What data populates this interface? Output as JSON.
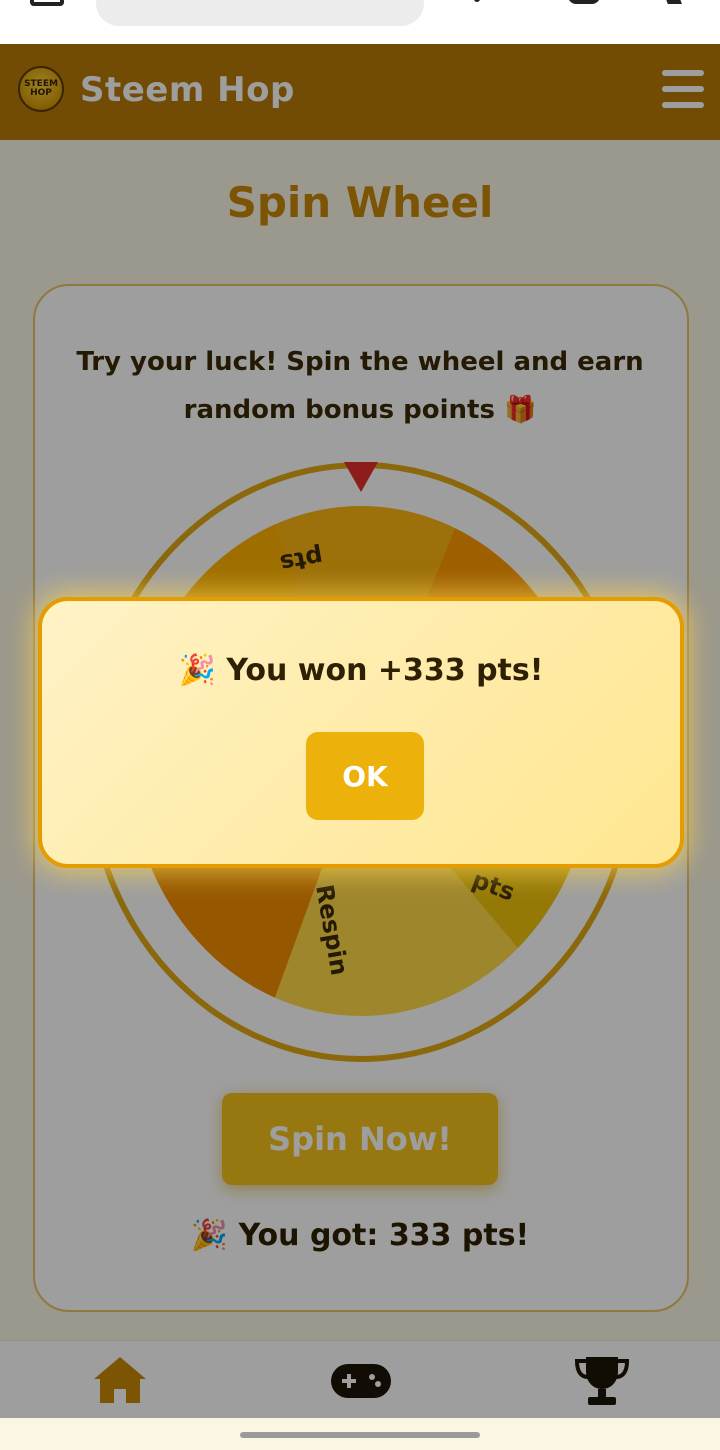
{
  "app": {
    "title": "Steem Hop",
    "logo_text": "STEEM HOP"
  },
  "page": {
    "title": "Spin Wheel",
    "intro": "Try your luck! Spin the wheel and earn random bonus points 🎁"
  },
  "wheel": {
    "labels": [
      "pts",
      "pts",
      "Respin"
    ]
  },
  "spin_button_label": "Spin Now!",
  "result_text": "🎉 You got: 333 pts!",
  "modal": {
    "message": "🎉 You won +333 pts!",
    "ok_label": "OK"
  },
  "nav": {
    "items": [
      {
        "icon": "home-icon"
      },
      {
        "icon": "gamepad-icon"
      },
      {
        "icon": "trophy-icon"
      }
    ]
  },
  "colors": {
    "header": "#b87908",
    "accent": "#c9880b",
    "button": "#f4c21a",
    "ok_button": "#ecb20b",
    "pointer": "#e3302a"
  }
}
